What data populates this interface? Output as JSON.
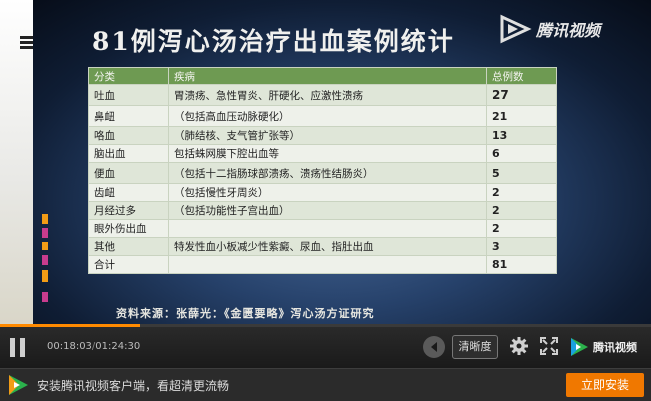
{
  "slide": {
    "title": "81例泻心汤治疗出血案例统计",
    "watermark": "腾讯视频",
    "table": {
      "headers": [
        "分类",
        "疾病",
        "总例数"
      ],
      "rows": [
        {
          "category": "吐血",
          "disease": "胃溃疡、急性胃炎、肝硬化、应激性溃疡",
          "count": "27"
        },
        {
          "category": "鼻衄",
          "disease": "（包括高血压动脉硬化）",
          "count": "21"
        },
        {
          "category": "咯血",
          "disease": "（肺结核、支气管扩张等）",
          "count": "13"
        },
        {
          "category": "脑出血",
          "disease": "包括蛛网膜下腔出血等",
          "count": "6"
        },
        {
          "category": "便血",
          "disease": "（包括十二指肠球部溃疡、溃疡性结肠炎）",
          "count": "5"
        },
        {
          "category": "齿衄",
          "disease": "（包括慢性牙周炎）",
          "count": "2"
        },
        {
          "category": "月经过多",
          "disease": "（包括功能性子宫出血）",
          "count": "2"
        },
        {
          "category": "眼外伤出血",
          "disease": "",
          "count": "2"
        },
        {
          "category": "其他",
          "disease": "特发性血小板减少性紫癜、尿血、指肚出血",
          "count": "3"
        },
        {
          "category": "合计",
          "disease": "",
          "count": "81"
        }
      ]
    },
    "source": "资料来源：张薛光：《金匮要略》泻心汤方证研究"
  },
  "player": {
    "progress_fraction": 0.2157,
    "time_current": "00:18:03",
    "time_total": "01:24:30",
    "quality_label": "清晰度",
    "brand": "腾讯视频",
    "icons": {
      "pause": "pause-icon",
      "volume": "volume-icon",
      "settings": "gear-icon",
      "fullscreen": "fullscreen-icon",
      "logo": "tencent-video-logo-icon"
    }
  },
  "banner": {
    "text": "安装腾讯视频客户端，看超清更流畅",
    "install_label": "立即安装"
  },
  "colors": {
    "accent": "#ff8a00",
    "table_header": "#6e9a52",
    "install_button": "#f07800"
  }
}
